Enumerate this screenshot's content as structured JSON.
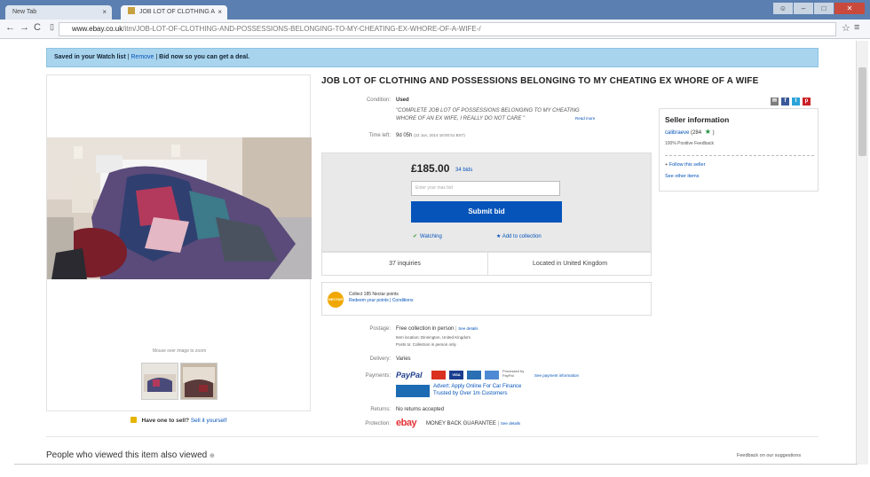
{
  "browser": {
    "tabs": [
      {
        "label": "New Tab"
      },
      {
        "label": "JOB LOT OF CLOTHING A"
      }
    ],
    "url_host": "www.ebay.co.uk",
    "url_path": "/itm/JOB-LOT-OF-CLOTHING-AND-POSSESSIONS-BELONGING-TO-MY-CHEATING-EX-WHORE-OF-A-WIFE-/"
  },
  "banner": {
    "watch_text": "Saved in your Watch list",
    "remove": "Remove",
    "bid_text": "Bid now so you can get a deal."
  },
  "item": {
    "title": "JOB LOT OF CLOTHING AND POSSESSIONS BELONGING TO MY CHEATING EX WHORE OF A WIFE",
    "condition_label": "Condition:",
    "condition": "Used",
    "condition_note_1": "\"COMPLETE JOB LOT OF POSSESSIONS BELONGING TO MY CHEATING",
    "condition_note_2": "WHORE OF AN EX WIFE, I REALLY DO NOT CARE \"",
    "read_more": "Read more",
    "time_left_label": "Time left:",
    "time_left": "9d 05h",
    "end_time": "(22 Jun, 2014 18:00:51 BST)"
  },
  "bid": {
    "price": "£185.00",
    "bids": "34 bids",
    "placeholder": "Enter your max bid",
    "submit": "Submit bid",
    "watching": "Watching",
    "add_collection": "Add to collection"
  },
  "strip": {
    "inquiries": "37 inquiries",
    "location": "Located in United Kingdom"
  },
  "rewards": {
    "badge": "NECTAR",
    "line1": "Collect 185 Nectar points",
    "line2": "Redeem your points | Conditions"
  },
  "shipping": {
    "postage_label": "Postage:",
    "postage": "Free collection in person",
    "see_details": "See details",
    "item_location": "Item location: Dinnington, United Kingdom",
    "posts_to": "Posts to: Collection in person only",
    "delivery_label": "Delivery:",
    "delivery": "Varies",
    "payments_label": "Payments:",
    "paypal": "PayPal",
    "processed": "Processed by PayPal",
    "see_payment": "See payment information",
    "credit_line1": "Advert: Apply Online For Car Finance",
    "credit_line2": "Trusted by Over 1m Customers",
    "returns_label": "Returns:",
    "returns": "No returns accepted",
    "protection_label": "Protection:",
    "ebay_logo": "ebay",
    "mbg": "MONEY BACK GUARANTEE",
    "see_details2": "See details"
  },
  "seller": {
    "heading": "Seller information",
    "name": "calibraeve",
    "score": "(284",
    "close": ")",
    "feedback": "100% Positive Feedback",
    "follow": "Follow this seller",
    "other_items": "See other items"
  },
  "gallery": {
    "hint": "Mouse over image to zoom",
    "sell_q": "Have one to sell?",
    "sell_link": "Sell it yourself"
  },
  "footer": {
    "people_viewed": "People who viewed this item also viewed",
    "feedback": "Feedback on our suggestions"
  },
  "colors": {
    "ebay_blue": "#0654ba",
    "banner": "#a9d4ee",
    "chrome": "#5a7fb0"
  },
  "icons": [
    "back-icon",
    "forward-icon",
    "reload-icon",
    "page-icon",
    "star-icon",
    "menu-icon",
    "email-icon",
    "facebook-icon",
    "twitter-icon",
    "pinterest-icon"
  ]
}
